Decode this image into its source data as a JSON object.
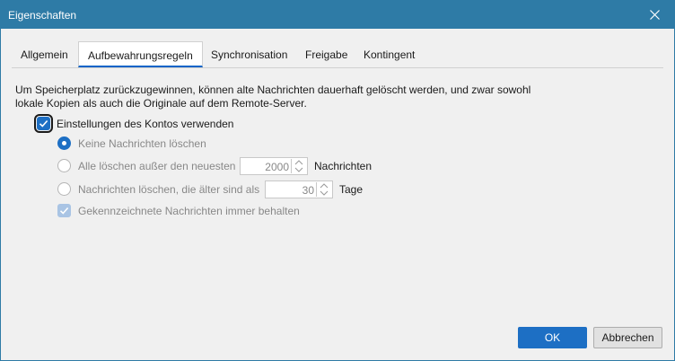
{
  "window": {
    "title": "Eigenschaften"
  },
  "tabs": [
    {
      "label": "Allgemein"
    },
    {
      "label": "Aufbewahrungsregeln"
    },
    {
      "label": "Synchronisation"
    },
    {
      "label": "Freigabe"
    },
    {
      "label": "Kontingent"
    }
  ],
  "description": "Um Speicherplatz zurückzugewinnen, können alte Nachrichten dauerhaft gelöscht werden, und zwar sowohl lokale Kopien als auch die Originale auf dem Remote-Server.",
  "account_settings": {
    "label": "Einstellungen des Kontos verwenden",
    "checked": true
  },
  "options": {
    "keep_all": {
      "label": "Keine Nachrichten löschen",
      "selected": true
    },
    "keep_newest": {
      "label": "Alle löschen außer den neuesten",
      "value": "2000",
      "unit": "Nachrichten"
    },
    "older_than": {
      "label": "Nachrichten löschen, die älter sind als",
      "value": "30",
      "unit": "Tage"
    },
    "keep_flagged": {
      "label": "Gekennzeichnete Nachrichten immer behalten",
      "checked": true
    }
  },
  "buttons": {
    "ok": "OK",
    "cancel": "Abbrechen"
  },
  "colors": {
    "accent": "#1d6fc4",
    "titlebar": "#2e7ba6"
  }
}
